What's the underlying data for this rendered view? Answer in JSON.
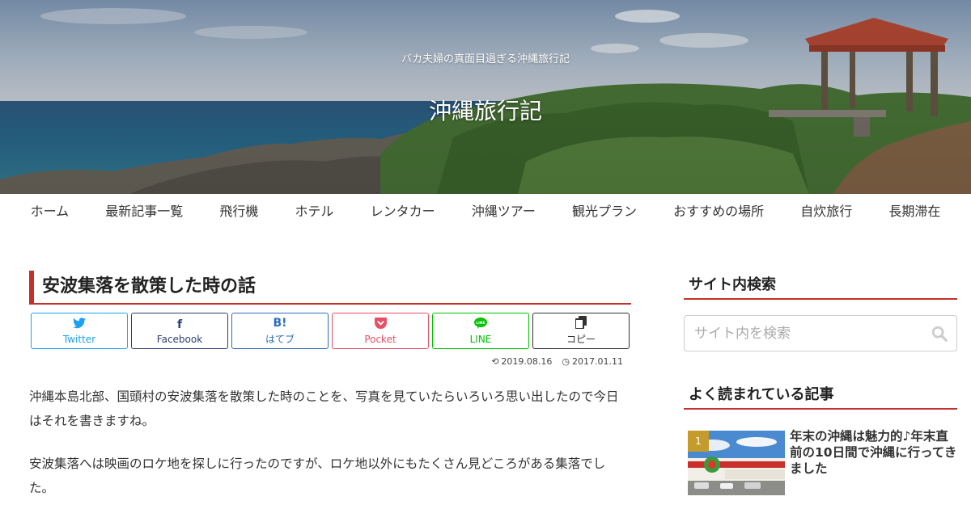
{
  "header": {
    "tagline": "バカ夫婦の真面目過ぎる沖縄旅行記",
    "site_title": "沖縄旅行記"
  },
  "nav": {
    "items": [
      "ホーム",
      "最新記事一覧",
      "飛行機",
      "ホテル",
      "レンタカー",
      "沖縄ツアー",
      "観光プラン",
      "おすすめの場所",
      "自炊旅行",
      "長期滞在"
    ]
  },
  "article": {
    "title": "安波集落を散策した時の話",
    "share": {
      "twitter": "Twitter",
      "facebook": "Facebook",
      "hatebu": "はてブ",
      "pocket": "Pocket",
      "line": "LINE",
      "copy": "コピー"
    },
    "updated_date": "2019.08.16",
    "published_date": "2017.01.11",
    "paragraphs": [
      "沖縄本島北部、国頭村の安波集落を散策した時のことを、写真を見ていたらいろいろ思い出したので今日はそれを書きますね。",
      "安波集落へは映画のロケ地を探しに行ったのですが、ロケ地以外にもたくさん見どころがある集落でした。"
    ]
  },
  "sidebar": {
    "search_heading": "サイト内検索",
    "search_placeholder": "サイト内を検索",
    "popular_heading": "よく読まれている記事",
    "popular": [
      {
        "rank": "1",
        "title": "年末の沖縄は魅力的♪年末直前の10日間で沖縄に行ってきました"
      }
    ]
  },
  "colors": {
    "accent": "#c4302b",
    "twitter": "#1da1f2",
    "facebook": "#2b4170",
    "hatebu": "#2c6ebd",
    "pocket": "#e94f64",
    "line": "#00c300",
    "rank_badge": "#c59b2b"
  },
  "icons": {
    "twitter": "twitter-bird-icon",
    "facebook": "facebook-f-icon",
    "hatebu": "hatena-bookmark-icon",
    "pocket": "pocket-icon",
    "line": "line-icon",
    "copy": "copy-icon",
    "updated": "refresh-icon",
    "published": "clock-icon",
    "search": "search-icon"
  }
}
